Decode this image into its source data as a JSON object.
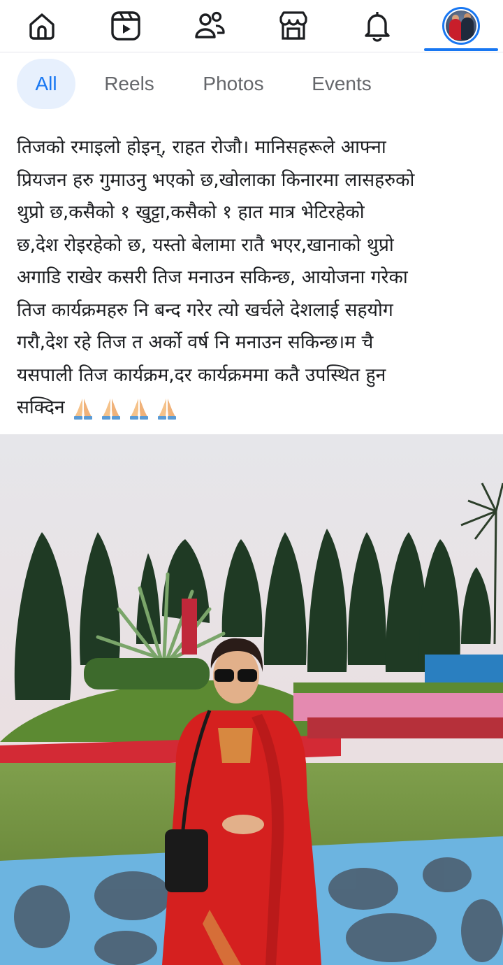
{
  "nav": {
    "items": [
      {
        "name": "home",
        "icon": "home-icon"
      },
      {
        "name": "reels",
        "icon": "video-icon"
      },
      {
        "name": "friends",
        "icon": "friends-icon"
      },
      {
        "name": "marketplace",
        "icon": "marketplace-icon"
      },
      {
        "name": "notifications",
        "icon": "bell-icon"
      },
      {
        "name": "profile",
        "icon": "avatar",
        "active": true
      }
    ],
    "accent_color": "#1877f2"
  },
  "filters": {
    "tabs": [
      {
        "label": "All",
        "active": true
      },
      {
        "label": "Reels",
        "active": false
      },
      {
        "label": "Photos",
        "active": false
      },
      {
        "label": "Events",
        "active": false
      }
    ]
  },
  "post": {
    "lines": [
      "तिजको रमाइलो होइन्, राहत रोजौ। मानिसहरूले आफ्ना",
      "प्रियजन हरु गुमाउनु भएको छ,खोलाका किनारमा लासहरुको",
      "थुप्रो छ,कसैको १ खुट्टा,कसैको १ हात मात्र भेटिरहेको",
      "छ,देश रोइरहेको छ, यस्तो बेलामा रातै भएर,खानाको थुप्रो",
      "अगाडि राखेर कसरी तिज मनाउन सकिन्छ, आयोजना गरेका",
      "तिज कार्यक्रमहरु नि बन्द गरेर त्यो खर्चले देशलाई सहयोग",
      "गरौ,देश रहे तिज त अर्को वर्ष नि मनाउन सकिन्छ।म चै",
      "यसपाली तिज कार्यक्रम,दर कार्यक्रममा कतै उपस्थित हुन",
      "सक्दिन"
    ],
    "emoji": [
      "folded-hands-emoji",
      "folded-hands-emoji",
      "folded-hands-emoji",
      "folded-hands-emoji"
    ]
  }
}
